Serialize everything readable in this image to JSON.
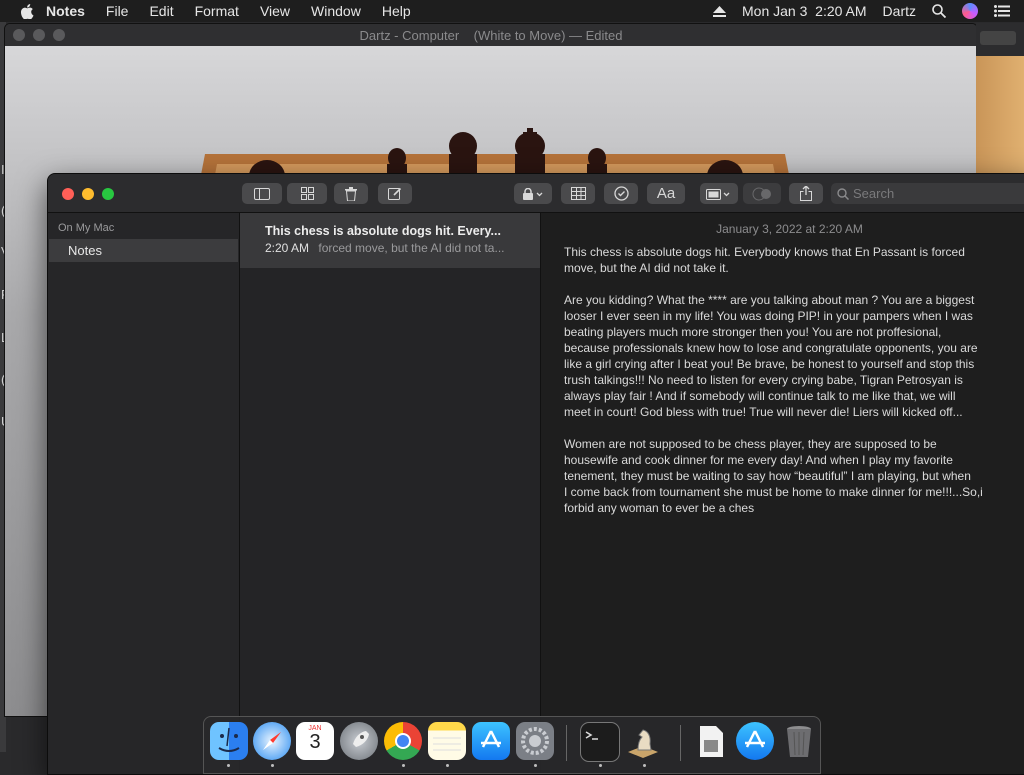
{
  "menubar": {
    "app_name": "Notes",
    "items": [
      "File",
      "Edit",
      "Format",
      "View",
      "Window",
      "Help"
    ],
    "datetime": "Mon Jan 3  2:20 AM",
    "user": "Dartz"
  },
  "background_window": {
    "title": "Dartz - Computer    (White to Move) — Edited",
    "side_chars": [
      "I",
      "(",
      "V",
      "P",
      "L",
      "(",
      "U"
    ]
  },
  "notes_window": {
    "toolbar": {
      "search_placeholder": "Search",
      "format_label": "Aa"
    },
    "sidebar": {
      "section": "On My Mac",
      "folder": "Notes"
    },
    "note_list": [
      {
        "title": "This chess is absolute dogs hit. Every...",
        "time": "2:20 AM",
        "preview": "forced move, but the AI did not ta..."
      }
    ],
    "editor": {
      "date": "January 3, 2022 at 2:20 AM",
      "paragraphs": [
        "This chess is absolute dogs hit. Everybody knows that En Passant is forced\nmove, but the AI did not take it.",
        "Are you kidding? What the **** are you talking about man ? You are a biggest\nlooser I ever seen in my life! You was doing PIP! in your pampers when I was\nbeating players much more stronger then you! You are not proffesional,\nbecause professionals knew how to lose and congratulate opponents, you are\nlike a girl crying after I beat you! Be brave, be honest to yourself and stop this\ntrush talkings!!! No need to listen for every crying babe, Tigran Petrosyan is\nalways play fair ! And if somebody will continue talk to me like that, we will\nmeet in court! God bless with true! True will never die! Liers will kicked off...",
        "Women are not supposed to be chess player, they are supposed to be\nhousewife and cook dinner for me every day! And when I play my favorite\ntenement, they must be waiting to say how “beautiful” I am playing, but when\nI come back from tournament she must be home to make dinner for me!!!...So,i\nforbid any woman to ever be a ches"
      ]
    }
  },
  "dock": {
    "calendar_month": "JAN",
    "calendar_day": "3",
    "apps": [
      "finder",
      "safari",
      "calendar",
      "launchpad",
      "chrome",
      "notes",
      "app-store",
      "system-preferences",
      "terminal",
      "chess",
      "preview",
      "app-store-download",
      "trash"
    ]
  }
}
